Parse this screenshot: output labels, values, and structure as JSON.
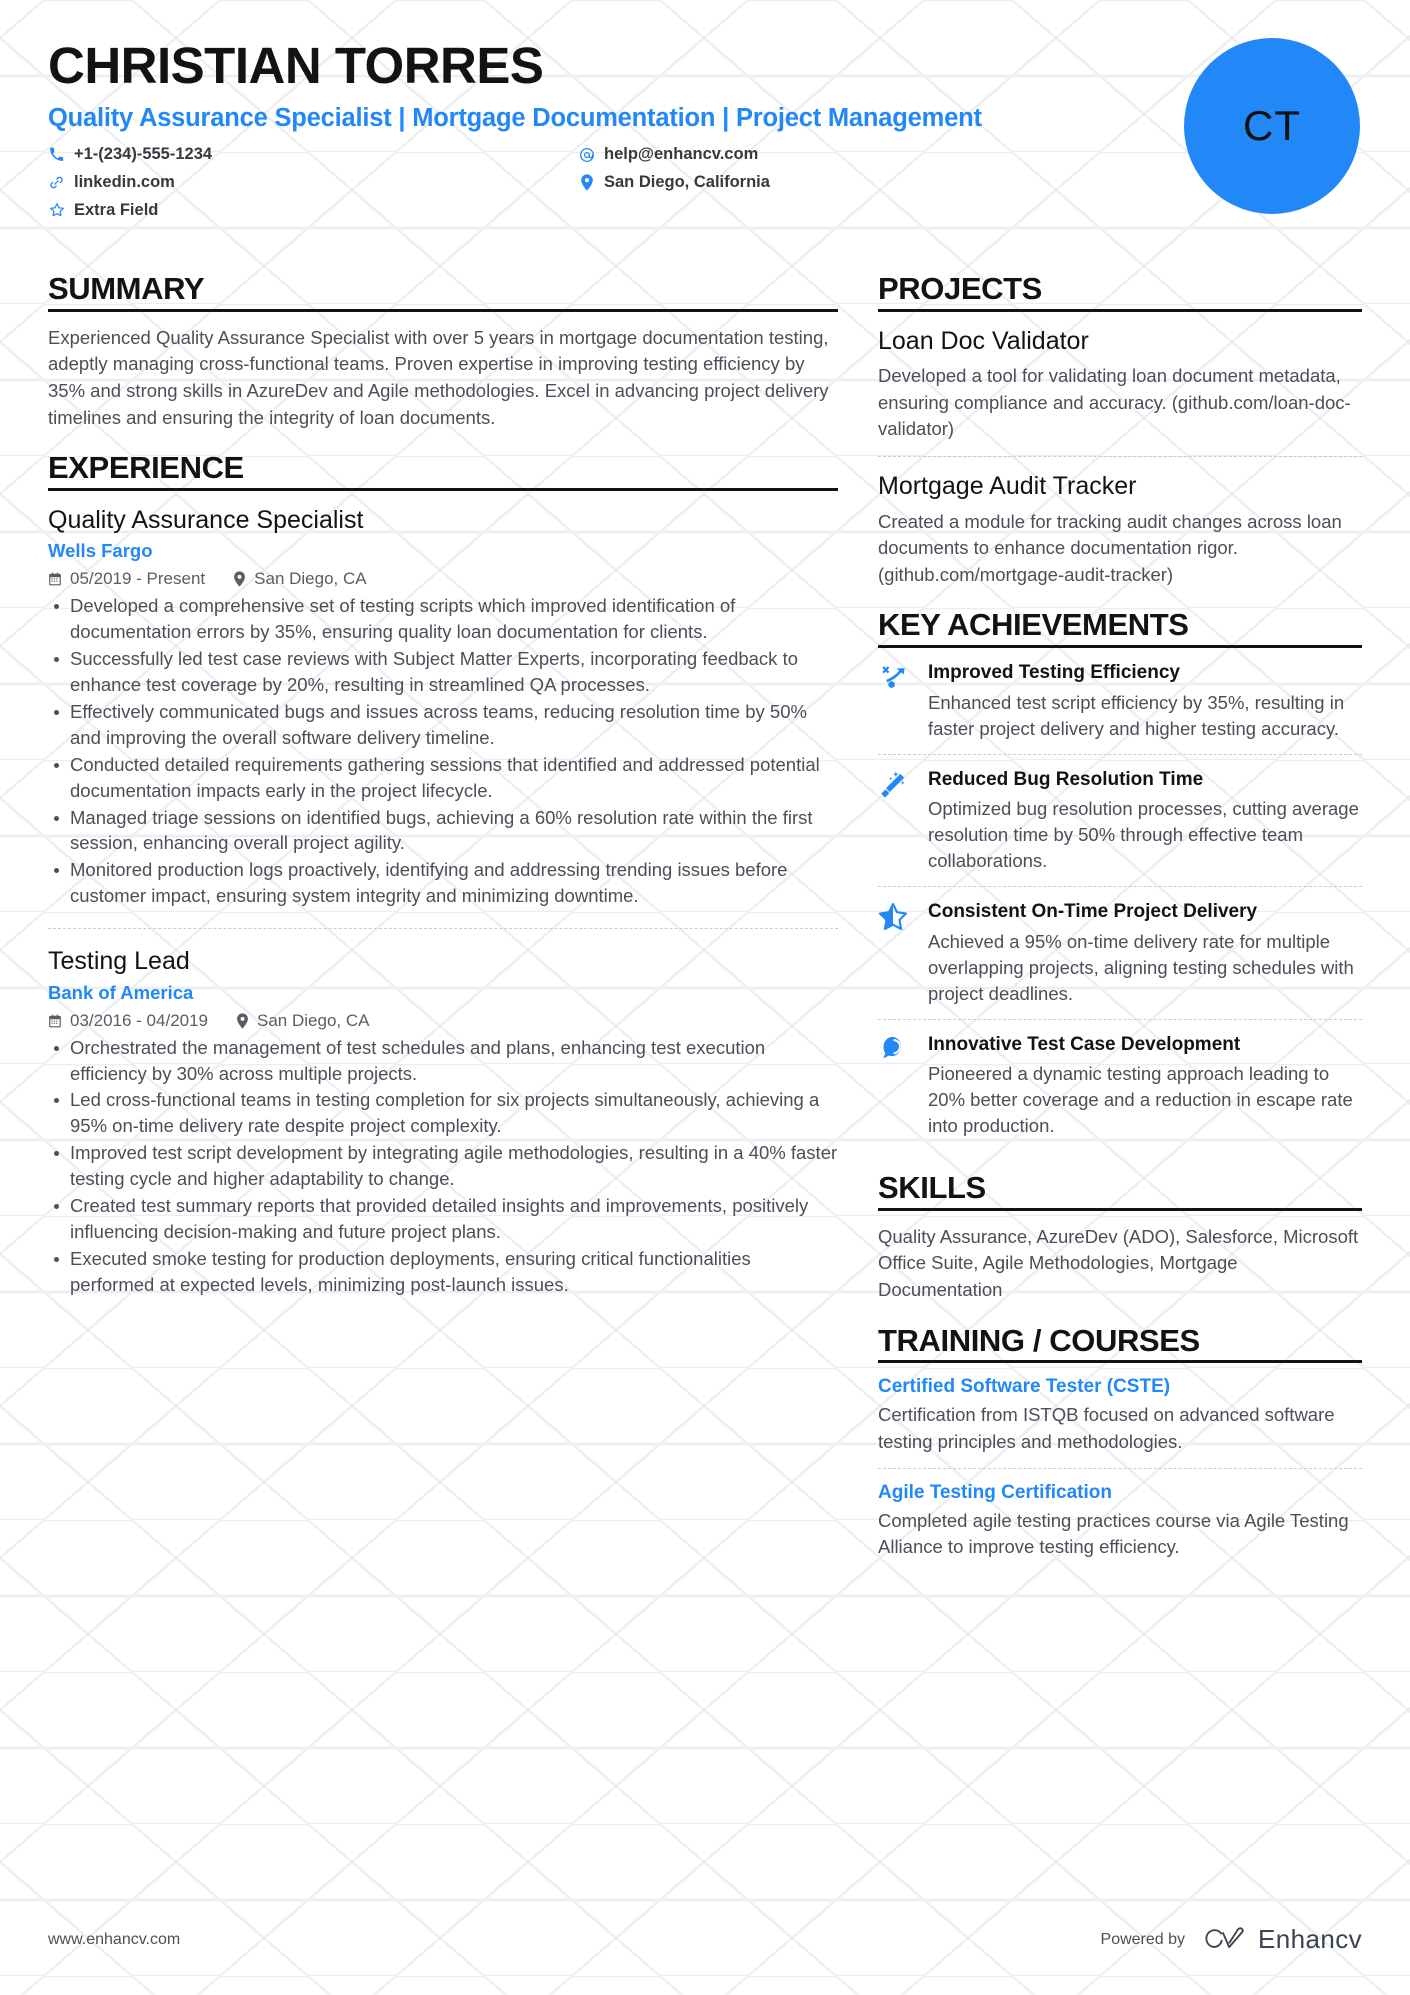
{
  "header": {
    "name": "Christian Torres",
    "headline": "Quality Assurance Specialist | Mortgage Documentation | Project Management",
    "avatar_initials": "CT",
    "accent_color": "#2288f8",
    "contacts": [
      {
        "icon": "phone-icon",
        "text": "+1-(234)-555-1234"
      },
      {
        "icon": "email-icon",
        "text": "help@enhancv.com"
      },
      {
        "icon": "link-icon",
        "text": "linkedin.com"
      },
      {
        "icon": "location-icon",
        "text": "San Diego, California"
      },
      {
        "icon": "star-icon",
        "text": "Extra Field"
      }
    ]
  },
  "summary": {
    "title": "Summary",
    "text": "Experienced Quality Assurance Specialist with over 5 years in mortgage documentation testing, adeptly managing cross-functional teams. Proven expertise in improving testing efficiency by 35% and strong skills in AzureDev and Agile methodologies. Excel in advancing project delivery timelines and ensuring the integrity of loan documents."
  },
  "experience": {
    "title": "Experience",
    "jobs": [
      {
        "role": "Quality Assurance Specialist",
        "company": "Wells Fargo",
        "dates": "05/2019 - Present",
        "location": "San Diego, CA",
        "bullets": [
          "Developed a comprehensive set of testing scripts which improved identification of documentation errors by 35%, ensuring quality loan documentation for clients.",
          "Successfully led test case reviews with Subject Matter Experts, incorporating feedback to enhance test coverage by 20%, resulting in streamlined QA processes.",
          "Effectively communicated bugs and issues across teams, reducing resolution time by 50% and improving the overall software delivery timeline.",
          "Conducted detailed requirements gathering sessions that identified and addressed potential documentation impacts early in the project lifecycle.",
          "Managed triage sessions on identified bugs, achieving a 60% resolution rate within the first session, enhancing overall project agility.",
          "Monitored production logs proactively, identifying and addressing trending issues before customer impact, ensuring system integrity and minimizing downtime."
        ]
      },
      {
        "role": "Testing Lead",
        "company": "Bank of America",
        "dates": "03/2016 - 04/2019",
        "location": "San Diego, CA",
        "bullets": [
          "Orchestrated the management of test schedules and plans, enhancing test execution efficiency by 30% across multiple projects.",
          "Led cross-functional teams in testing completion for six projects simultaneously, achieving a 95% on-time delivery rate despite project complexity.",
          "Improved test script development by integrating agile methodologies, resulting in a 40% faster testing cycle and higher adaptability to change.",
          "Created test summary reports that provided detailed insights and improvements, positively influencing decision-making and future project plans.",
          "Executed smoke testing for production deployments, ensuring critical functionalities performed at expected levels, minimizing post-launch issues."
        ]
      }
    ]
  },
  "projects": {
    "title": "Projects",
    "items": [
      {
        "name": "Loan Doc Validator",
        "description": "Developed a tool for validating loan document metadata, ensuring compliance and accuracy. (github.com/loan-doc-validator)"
      },
      {
        "name": "Mortgage Audit Tracker",
        "description": "Created a module for tracking audit changes across loan documents to enhance documentation rigor. (github.com/mortgage-audit-tracker)"
      }
    ]
  },
  "achievements": {
    "title": "Key Achievements",
    "items": [
      {
        "icon": "trend-arrow-icon",
        "title": "Improved Testing Efficiency",
        "description": "Enhanced test script efficiency by 35%, resulting in faster project delivery and higher testing accuracy."
      },
      {
        "icon": "magic-wand-icon",
        "title": "Reduced Bug Resolution Time",
        "description": "Optimized bug resolution processes, cutting average resolution time by 50% through effective team collaborations."
      },
      {
        "icon": "half-star-icon",
        "title": "Consistent On-Time Project Delivery",
        "description": "Achieved a 95% on-time delivery rate for multiple overlapping projects, aligning testing schedules with project deadlines."
      },
      {
        "icon": "lightbulb-head-icon",
        "title": "Innovative Test Case Development",
        "description": "Pioneered a dynamic testing approach leading to 20% better coverage and a reduction in escape rate into production."
      }
    ]
  },
  "skills": {
    "title": "Skills",
    "text": "Quality Assurance, AzureDev (ADO), Salesforce, Microsoft Office Suite, Agile Methodologies, Mortgage Documentation"
  },
  "training": {
    "title": "Training / Courses",
    "items": [
      {
        "name": "Certified Software Tester (CSTE)",
        "description": "Certification from ISTQB focused on advanced software testing principles and methodologies."
      },
      {
        "name": "Agile Testing Certification",
        "description": "Completed agile testing practices course via Agile Testing Alliance to improve testing efficiency."
      }
    ]
  },
  "footer": {
    "url": "www.enhancv.com",
    "powered_by": "Powered by",
    "brand": "Enhancv"
  }
}
